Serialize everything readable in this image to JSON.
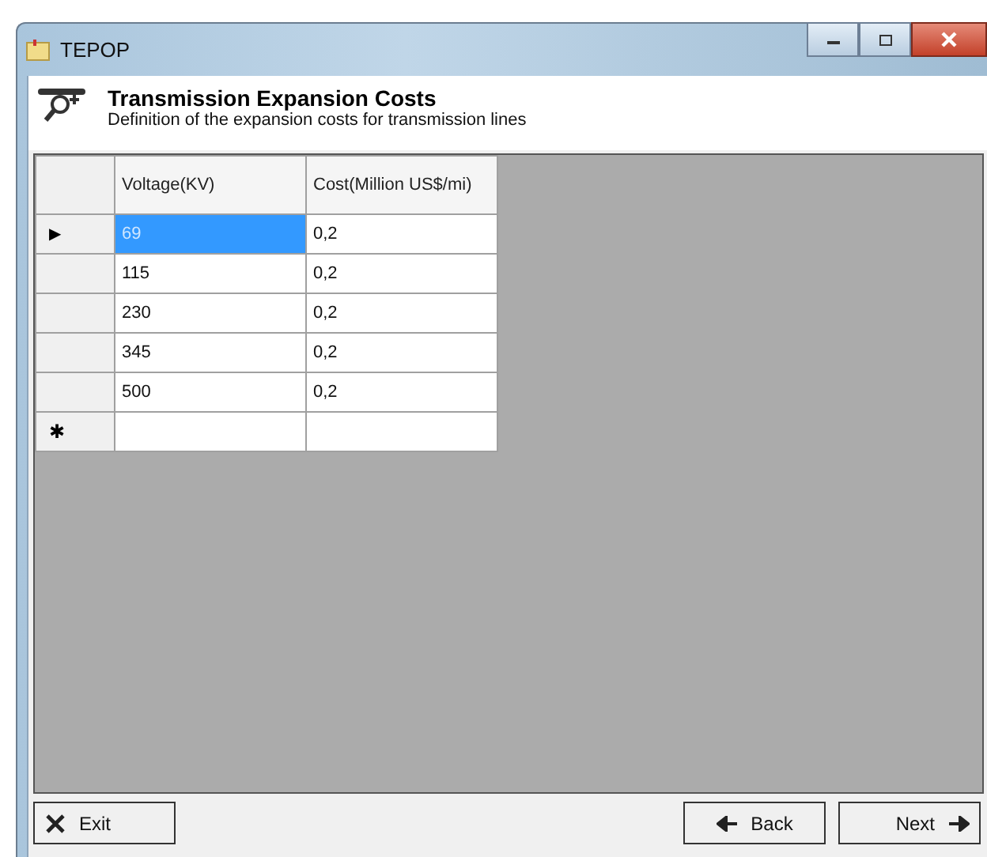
{
  "window": {
    "title": "TEPOP"
  },
  "header": {
    "title": "Transmission Expansion Costs",
    "subtitle": "Definition of the expansion costs for transmission lines"
  },
  "table": {
    "columns": [
      "Voltage(KV)",
      "Cost(Million US$/mi)"
    ],
    "rows": [
      {
        "indicator": "▶",
        "cells": [
          {
            "text": "69",
            "selected": true
          },
          {
            "text": "0,2",
            "selected": false
          }
        ]
      },
      {
        "cells": [
          {
            "text": "115",
            "selected": false
          },
          {
            "text": "0,2",
            "selected": false
          }
        ]
      },
      {
        "cells": [
          {
            "text": "230",
            "selected": false
          },
          {
            "text": "0,2",
            "selected": false
          }
        ]
      },
      {
        "cells": [
          {
            "text": "345",
            "selected": false
          },
          {
            "text": "0,2",
            "selected": false
          }
        ]
      },
      {
        "cells": [
          {
            "text": "500",
            "selected": false
          },
          {
            "text": "0,2",
            "selected": false
          }
        ]
      }
    ],
    "new_row": {
      "indicator": "✱"
    }
  },
  "buttons": [
    {
      "kind": "exit",
      "label": "Exit"
    },
    {
      "kind": "back",
      "label": "Back"
    },
    {
      "kind": "next",
      "label": "Next"
    }
  ]
}
